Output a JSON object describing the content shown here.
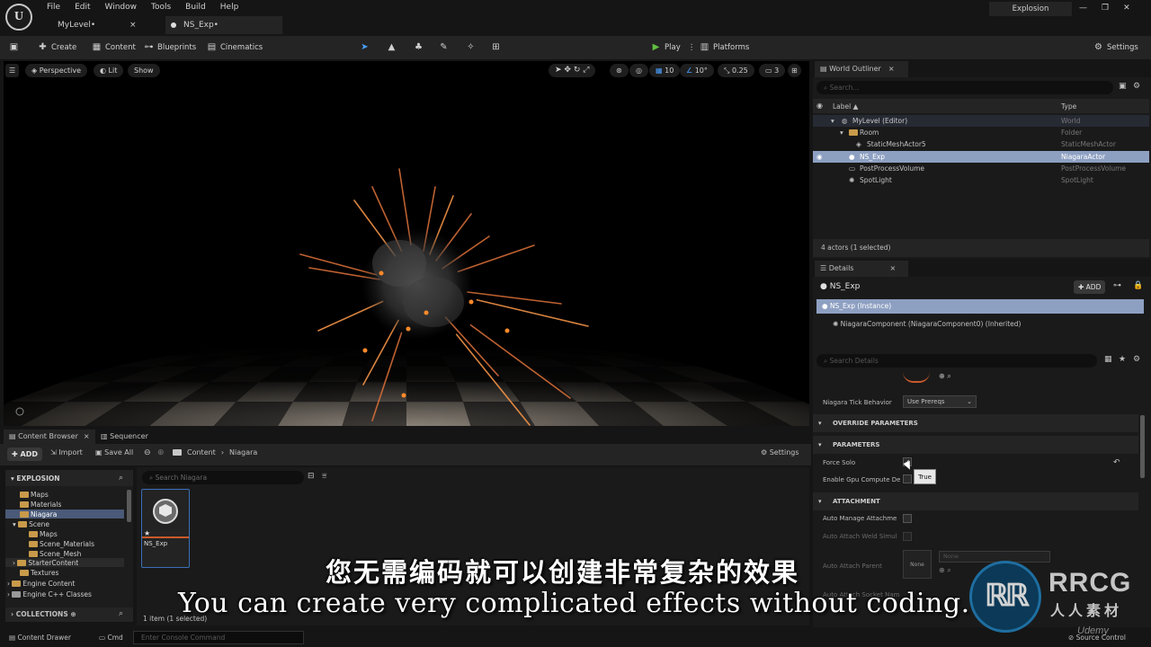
{
  "app": {
    "menus": [
      "File",
      "Edit",
      "Window",
      "Tools",
      "Build",
      "Help"
    ],
    "tabs": [
      "MyLevel•",
      "NS_Exp•"
    ],
    "project_name": "Explosion"
  },
  "toolbar": {
    "create": "Create",
    "content": "Content",
    "blueprints": "Blueprints",
    "cinematics": "Cinematics",
    "play": "Play",
    "platforms": "Platforms",
    "settings": "Settings"
  },
  "viewport": {
    "perspective": "Perspective",
    "lit": "Lit",
    "show": "Show",
    "grid_snap": "10",
    "rot_snap": "10°",
    "scale_snap": "0.25",
    "camera_speed": "3"
  },
  "content_browser": {
    "tab_label": "Content Browser",
    "sequencer_tab": "Sequencer",
    "add": "ADD",
    "import": "Import",
    "save_all": "Save All",
    "breadcrumb": [
      "Content",
      "Niagara"
    ],
    "settings": "Settings",
    "root": "EXPLOSION",
    "search_placeholder": "Search Niagara",
    "tree": [
      "Maps",
      "Materials",
      "Niagara",
      "Scene",
      "Maps",
      "Scene_Materials",
      "Scene_Mesh",
      "StarterContent",
      "Textures",
      "Engine Content",
      "Engine C++ Classes"
    ],
    "collections": "COLLECTIONS",
    "asset_name": "NS_Exp",
    "item_count": "1 item (1 selected)"
  },
  "statusbar": {
    "content_drawer": "Content Drawer",
    "cmd": "Cmd",
    "console_placeholder": "Enter Console Command",
    "source_control": "Source Control"
  },
  "outliner": {
    "tab_label": "World Outliner",
    "search_placeholder": "Search...",
    "col_label": "Label ▲",
    "col_type": "Type",
    "rows": [
      {
        "label": "MyLevel (Editor)",
        "type": "World"
      },
      {
        "label": "Room",
        "type": "Folder"
      },
      {
        "label": "StaticMeshActor5",
        "type": "StaticMeshActor"
      },
      {
        "label": "NS_Exp",
        "type": "NiagaraActor"
      },
      {
        "label": "PostProcessVolume",
        "type": "PostProcessVolume"
      },
      {
        "label": "SpotLight",
        "type": "SpotLight"
      }
    ],
    "summary": "4 actors (1 selected)"
  },
  "details": {
    "tab_label": "Details",
    "actor_name": "NS_Exp",
    "add": "ADD",
    "instance": "NS_Exp (Instance)",
    "component": "NiagaraComponent (NiagaraComponent0) (Inherited)",
    "search_placeholder": "Search Details",
    "tick_behavior_label": "Niagara Tick Behavior",
    "tick_behavior_value": "Use Prereqs",
    "section_override": "OVERRIDE PARAMETERS",
    "section_parameters": "PARAMETERS",
    "force_solo": "Force Solo",
    "tooltip": "True",
    "gpu_compute": "Enable Gpu Compute De",
    "section_attachment": "ATTACHMENT",
    "auto_manage": "Auto Manage Attachme",
    "auto_weld": "Auto Attach Weld Simul",
    "auto_parent": "Auto Attach Parent",
    "none_label": "None",
    "none_dropdown": "None",
    "auto_socket": "Auto Attach Socket Nam"
  },
  "subtitles": {
    "chinese": "您无需编码就可以创建非常复杂的效果",
    "english": "You can create very complicated effects without coding."
  },
  "watermark": {
    "brand": "RRCG",
    "sub": "人人素材",
    "udemy": "Udemy"
  }
}
